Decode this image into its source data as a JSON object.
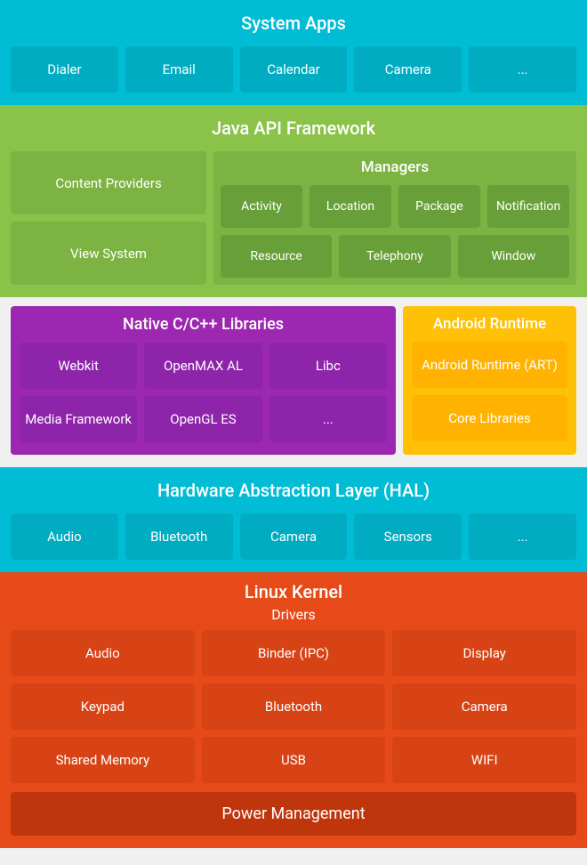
{
  "system_apps": {
    "title": "System Apps",
    "items": [
      "Dialer",
      "Email",
      "Calendar",
      "Camera",
      "..."
    ]
  },
  "java_api": {
    "title": "Java API Framework",
    "left_items": [
      "Content Providers",
      "View System"
    ],
    "managers_title": "Managers",
    "manager_rows": [
      [
        "Activity",
        "Location",
        "Package",
        "Notification"
      ],
      [
        "Resource",
        "Telephony",
        "Window"
      ]
    ]
  },
  "native": {
    "title": "Native C/C++ Libraries",
    "rows": [
      [
        "Webkit",
        "OpenMAX AL",
        "Libc"
      ],
      [
        "Media Framework",
        "OpenGL ES",
        "..."
      ]
    ]
  },
  "android_runtime": {
    "title": "Android Runtime",
    "items": [
      "Android Runtime (ART)",
      "Core Libraries"
    ]
  },
  "hal": {
    "title": "Hardware Abstraction Layer (HAL)",
    "items": [
      "Audio",
      "Bluetooth",
      "Camera",
      "Sensors",
      "..."
    ]
  },
  "linux": {
    "title": "Linux Kernel",
    "drivers_title": "Drivers",
    "rows": [
      [
        "Audio",
        "Binder (IPC)",
        "Display"
      ],
      [
        "Keypad",
        "Bluetooth",
        "Camera"
      ],
      [
        "Shared Memory",
        "USB",
        "WIFI"
      ]
    ],
    "power_management": "Power Management"
  }
}
